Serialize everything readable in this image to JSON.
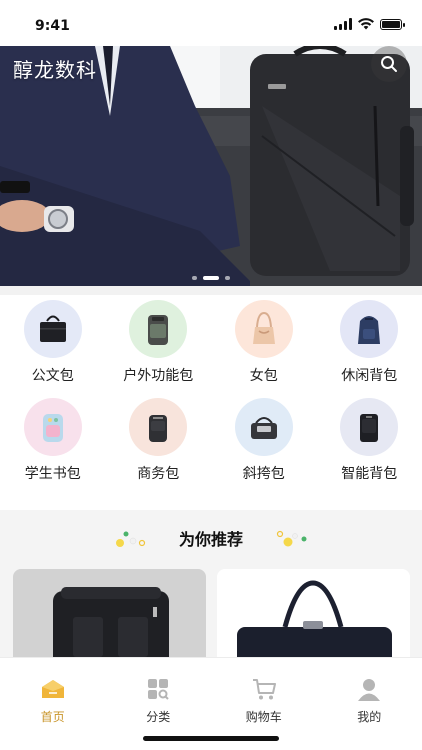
{
  "status": {
    "time": "9:41"
  },
  "banner": {
    "brand": "醇龙数科",
    "slide_count": 3,
    "active_slide": 1
  },
  "categories": [
    {
      "label": "公文包",
      "icon": "briefcase-icon",
      "bg": "#e4e9f7"
    },
    {
      "label": "户外功能包",
      "icon": "outdoor-backpack-icon",
      "bg": "#dff1de"
    },
    {
      "label": "女包",
      "icon": "handbag-icon",
      "bg": "#fde6da"
    },
    {
      "label": "休闲背包",
      "icon": "casual-backpack-icon",
      "bg": "#e3e6f6"
    },
    {
      "label": "学生书包",
      "icon": "school-bag-icon",
      "bg": "#f8e1ec"
    },
    {
      "label": "商务包",
      "icon": "business-bag-icon",
      "bg": "#f8e4dc"
    },
    {
      "label": "斜挎包",
      "icon": "crossbody-bag-icon",
      "bg": "#e0ebf7"
    },
    {
      "label": "智能背包",
      "icon": "smart-backpack-icon",
      "bg": "#e6e8f3"
    }
  ],
  "recommend": {
    "title": "为你推荐"
  },
  "tabs": [
    {
      "label": "首页",
      "icon": "home-icon",
      "active": true
    },
    {
      "label": "分类",
      "icon": "category-icon",
      "active": false
    },
    {
      "label": "购物车",
      "icon": "cart-icon",
      "active": false
    },
    {
      "label": "我的",
      "icon": "profile-icon",
      "active": false
    }
  ],
  "colors": {
    "accent": "#c9952a",
    "tab_inactive": "#9a9a9a"
  }
}
